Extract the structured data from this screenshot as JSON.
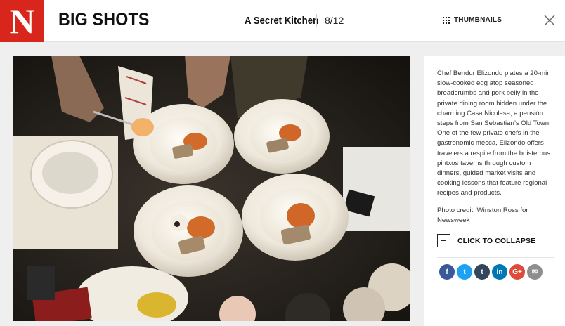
{
  "header": {
    "logo_letter": "N",
    "brand": "BIG SHOTS",
    "gallery_title": "A Secret Kitchen",
    "counter": "8/12",
    "thumbnails_label": "THUMBNAILS"
  },
  "slide": {
    "caption": "Chef Bendur Elizondo plates a 20-min slow-cooked egg atop seasoned breadcrumbs and pork belly in the private dining room hidden under the charming Casa Nicolasa, a pensión steps from San Sebastian’s Old Town. One of the few private chefs in the gastronomic mecca, Elizondo offers travelers a respite from the boisterous pintxos taverns through custom dinners, guided market visits and cooking lessons that feature regional recipes and products.",
    "credit": "Photo credit: Winston Ross for Newsweek",
    "collapse_label": "CLICK TO COLLAPSE"
  },
  "share": [
    {
      "icon": "facebook-icon",
      "glyph": "f",
      "color": "#3b5998"
    },
    {
      "icon": "twitter-icon",
      "glyph": "t",
      "color": "#1da1f2"
    },
    {
      "icon": "tumblr-icon",
      "glyph": "t",
      "color": "#34465d"
    },
    {
      "icon": "linkedin-icon",
      "glyph": "in",
      "color": "#0077b5"
    },
    {
      "icon": "googleplus-icon",
      "glyph": "G+",
      "color": "#dd4b39"
    },
    {
      "icon": "email-icon",
      "glyph": "✉",
      "color": "#8e8e8e"
    }
  ]
}
